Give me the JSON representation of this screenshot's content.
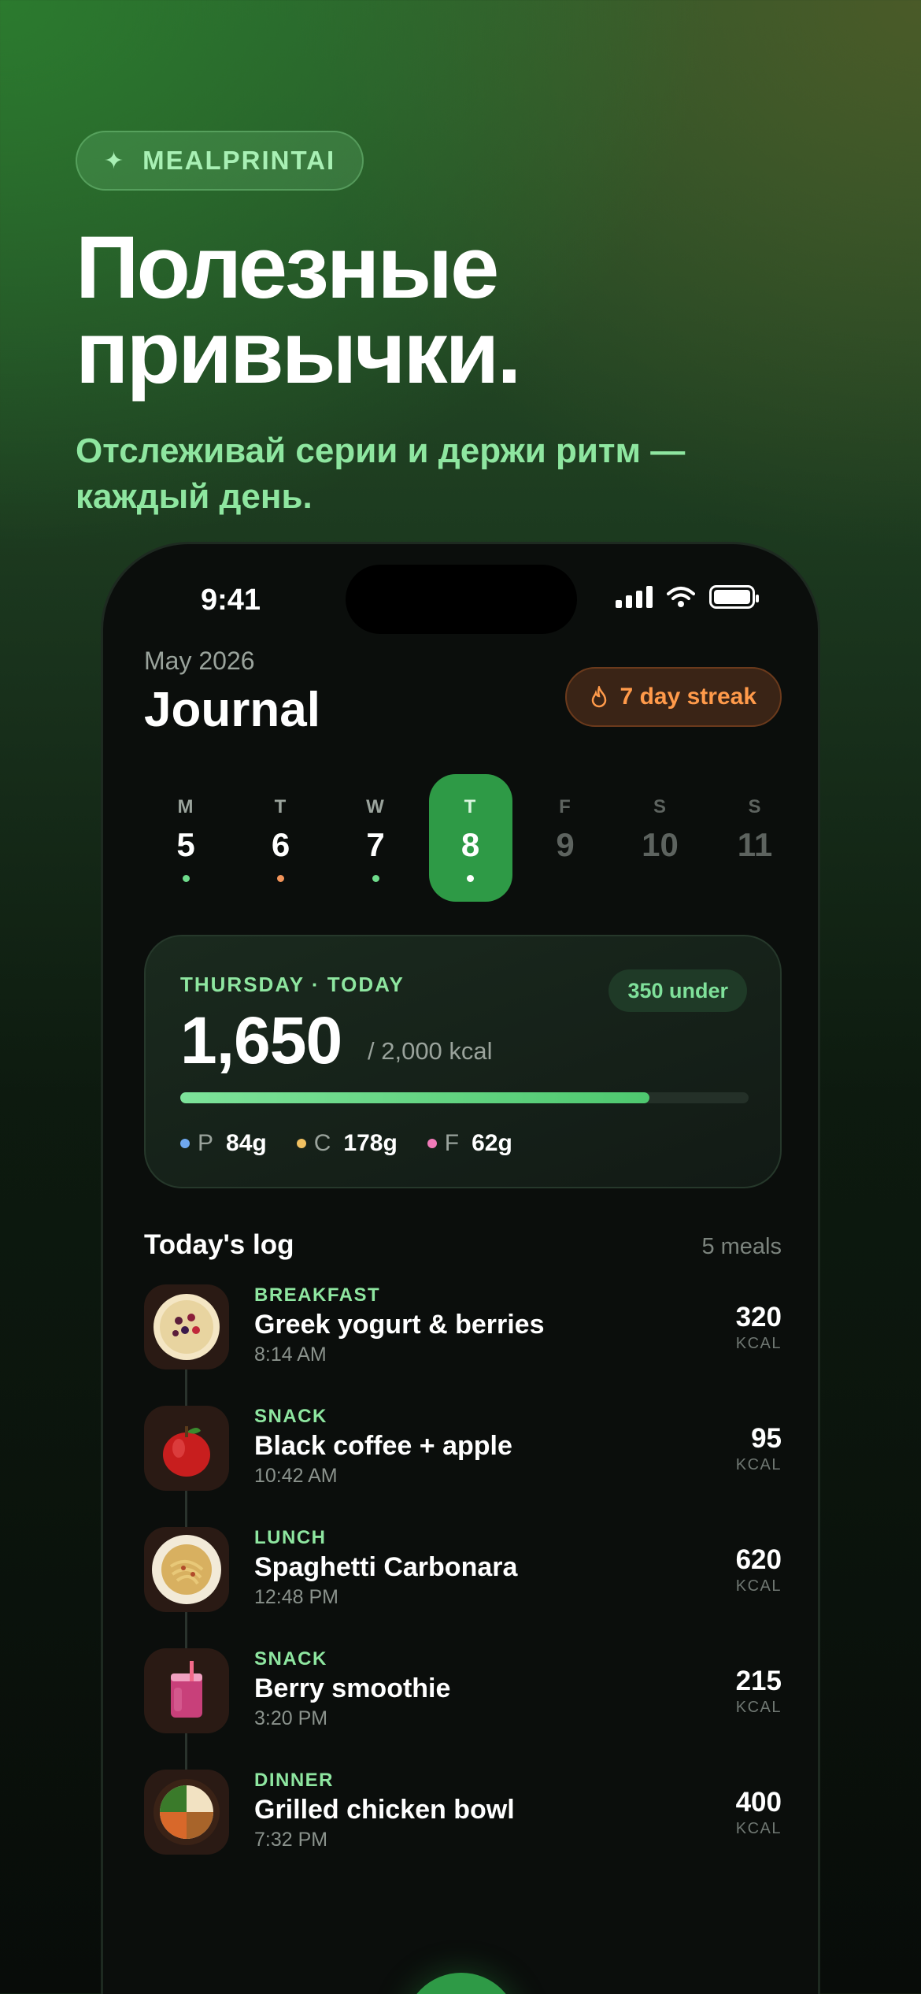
{
  "hero": {
    "brand": "MEALPRINTAI",
    "headline_line1": "Полезные",
    "headline_line2": "привычки.",
    "subline_line1": "Отслеживай серии и держи ритм —",
    "subline_line2": "каждый день."
  },
  "status_bar": {
    "time": "9:41"
  },
  "header": {
    "month": "May 2026",
    "title": "Journal",
    "streak": "7 day streak"
  },
  "week": [
    {
      "letter": "M",
      "date": "5",
      "dot": "#6fdc8c",
      "state": "past"
    },
    {
      "letter": "T",
      "date": "6",
      "dot": "#f2945a",
      "state": "past"
    },
    {
      "letter": "W",
      "date": "7",
      "dot": "#6fdc8c",
      "state": "past"
    },
    {
      "letter": "T",
      "date": "8",
      "dot": "#ffffff",
      "state": "active"
    },
    {
      "letter": "F",
      "date": "9",
      "dot": "",
      "state": "future"
    },
    {
      "letter": "S",
      "date": "10",
      "dot": "",
      "state": "future"
    },
    {
      "letter": "S",
      "date": "11",
      "dot": "",
      "state": "future"
    }
  ],
  "summary": {
    "label": "THURSDAY · TODAY",
    "badge": "350 under",
    "calories": "1,650",
    "goal": "/ 2,000 kcal",
    "progress": 0.825,
    "macros": [
      {
        "key": "P",
        "value": "84g",
        "color": "#6fa8f0"
      },
      {
        "key": "C",
        "value": "178g",
        "color": "#f0c060"
      },
      {
        "key": "F",
        "value": "62g",
        "color": "#f07ab8"
      }
    ]
  },
  "log": {
    "title": "Today's log",
    "count": "5 meals",
    "meals": [
      {
        "type": "BREAKFAST",
        "name": "Greek yogurt & berries",
        "time": "8:14 AM",
        "kcal": "320",
        "unit": "KCAL",
        "icon": "yogurt-bowl-icon"
      },
      {
        "type": "SNACK",
        "name": "Black coffee + apple",
        "time": "10:42 AM",
        "kcal": "95",
        "unit": "KCAL",
        "icon": "apple-icon"
      },
      {
        "type": "LUNCH",
        "name": "Spaghetti Carbonara",
        "time": "12:48 PM",
        "kcal": "620",
        "unit": "KCAL",
        "icon": "pasta-plate-icon"
      },
      {
        "type": "SNACK",
        "name": "Berry smoothie",
        "time": "3:20 PM",
        "kcal": "215",
        "unit": "KCAL",
        "icon": "smoothie-glass-icon"
      },
      {
        "type": "DINNER",
        "name": "Grilled chicken bowl",
        "time": "7:32 PM",
        "kcal": "400",
        "unit": "KCAL",
        "icon": "chicken-bowl-icon"
      }
    ]
  },
  "tabbar": [
    "home-icon",
    "calendar-icon",
    "camera-icon",
    "bolt-icon",
    "profile-icon"
  ],
  "colors": {
    "accent": "#2e9a46",
    "accent_text": "#8ee6a0",
    "streak": "#ff9a4a"
  }
}
